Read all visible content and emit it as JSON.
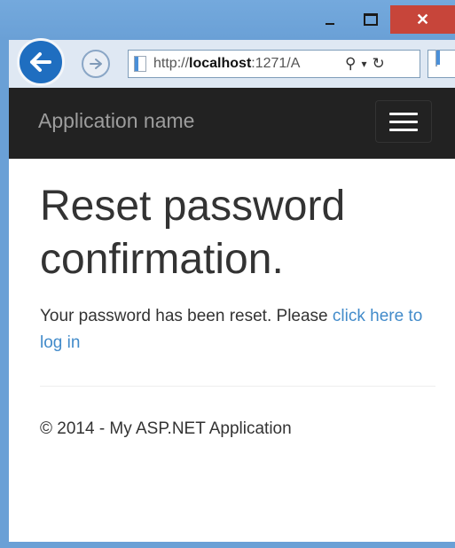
{
  "window": {
    "minimize_glyph": "–",
    "close_glyph": "✕"
  },
  "browser": {
    "url_prefix": "http://",
    "url_host": "localhost",
    "url_suffix": ":1271/A",
    "back_icon": "back-arrow-icon",
    "forward_icon": "forward-arrow-icon",
    "search_glyph": "⚲",
    "dropdown_glyph": "▾",
    "refresh_glyph": "↻"
  },
  "navbar": {
    "brand": "Application name",
    "background": "#222222",
    "brand_color": "#9d9d9d"
  },
  "main": {
    "title": "Reset password confirmation.",
    "message": "Your password has been reset. Please ",
    "login_link": "click here to log in",
    "link_color": "#428bca"
  },
  "footer": {
    "text": "© 2014 - My ASP.NET Application"
  }
}
